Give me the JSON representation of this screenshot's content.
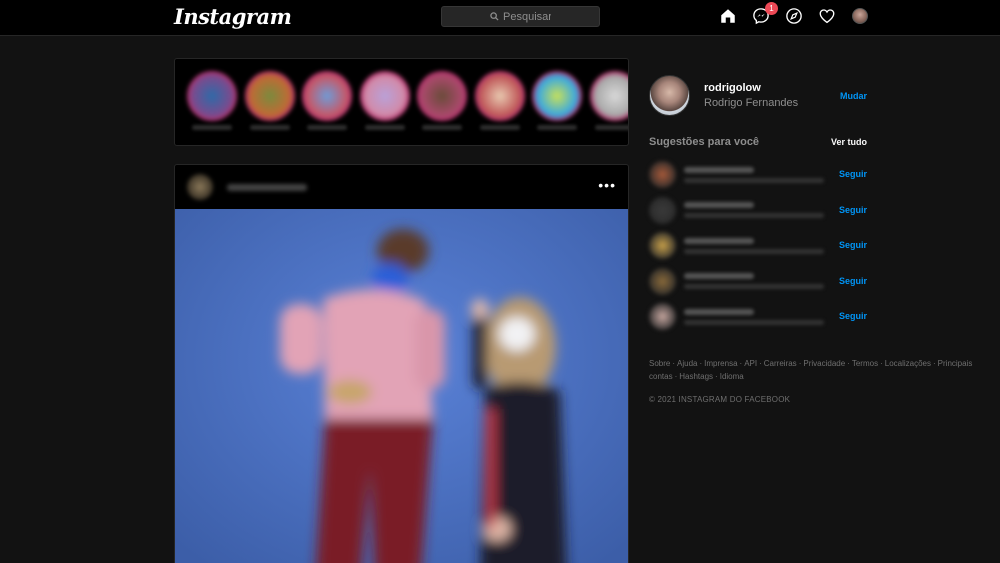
{
  "header": {
    "logo": "Instagram",
    "search_placeholder": "Pesquisar",
    "messages_badge": "1"
  },
  "stories": [
    {
      "colors": [
        "#2e6aa8",
        "#7a4b8e"
      ]
    },
    {
      "colors": [
        "#7a8b3d",
        "#c06a35"
      ]
    },
    {
      "colors": [
        "#6f9bd6",
        "#c45a6a"
      ]
    },
    {
      "colors": [
        "#b9a1d8",
        "#d28aa8"
      ]
    },
    {
      "colors": [
        "#6a4b3a",
        "#a84a6a"
      ]
    },
    {
      "colors": [
        "#e8c9b0",
        "#c05a5a"
      ]
    },
    {
      "colors": [
        "#c7e05a",
        "#3aa8e0"
      ]
    },
    {
      "colors": [
        "#d8d8d8",
        "#a8a8a8"
      ]
    }
  ],
  "post": {
    "more_label": "•••"
  },
  "profile": {
    "username": "rodrigolow",
    "name": "Rodrigo Fernandes",
    "switch_label": "Mudar"
  },
  "suggestions": {
    "title": "Sugestões para você",
    "see_all": "Ver tudo",
    "follow_label": "Seguir",
    "items": [
      {
        "avatar_color": "#a85a3a"
      },
      {
        "avatar_color": "#3a3a3a"
      },
      {
        "avatar_color": "#c9a14a"
      },
      {
        "avatar_color": "#8a6a3a"
      },
      {
        "avatar_color": "#c7a7a0"
      }
    ]
  },
  "footer": {
    "links": [
      "Sobre",
      "Ajuda",
      "Imprensa",
      "API",
      "Carreiras",
      "Privacidade",
      "Termos",
      "Localizações",
      "Principais contas",
      "Hashtags",
      "Idioma"
    ],
    "separator": "·",
    "copyright": "© 2021 INSTAGRAM DO FACEBOOK"
  },
  "colors": {
    "accent": "#0095f6",
    "background": "#121212",
    "badge": "#ed4956"
  }
}
